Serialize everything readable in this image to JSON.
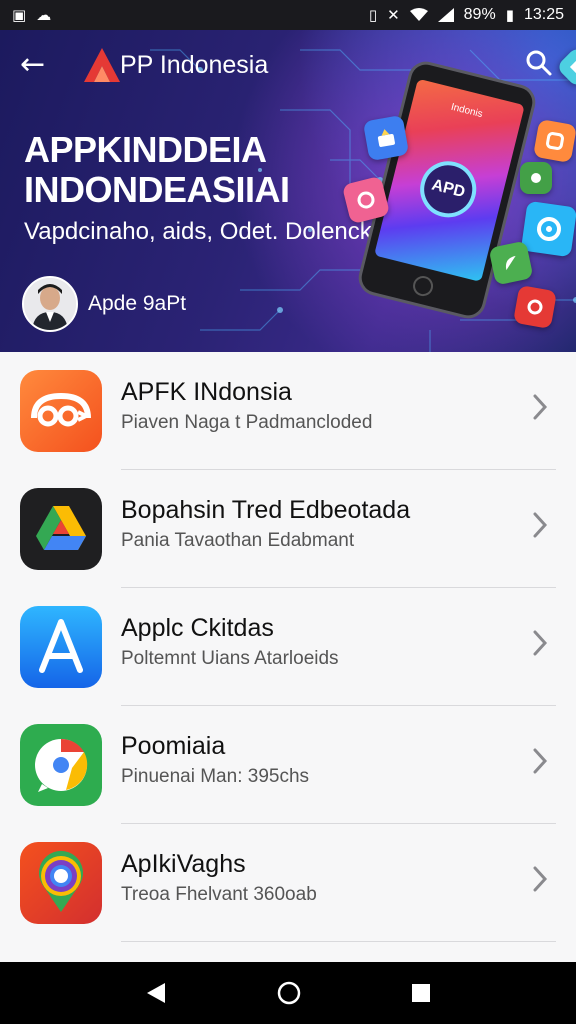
{
  "status_bar": {
    "battery": "89%",
    "time": "13:25",
    "glyphs": {
      "image": "▣",
      "cloud": "☁",
      "vibrate": "▯",
      "mute": "✕",
      "battery": "▮"
    }
  },
  "header": {
    "back_glyph": "←",
    "brand_letter": "A",
    "brand_text": "PP Indonesia",
    "title_line1": "APPKINDDEIA",
    "title_line2": "INDONDEASIIAI",
    "subtitle": "Vapdcinaho, aids, Odet. Dolenck",
    "author_name": "Apde 9aPt",
    "phone_label": "Indonis",
    "phone_badge": "APD"
  },
  "apps": [
    {
      "title": "APFK INdonsia",
      "subtitle": "Piaven Naga t Padmancloded",
      "icon": "orange-app-icon"
    },
    {
      "title": "Bopahsin Tred Edbeotada",
      "subtitle": "Pania Tavaothan Edabmant",
      "icon": "drive-app-icon"
    },
    {
      "title": "Applc Ckitdas",
      "subtitle": "Poltemnt Uians Atarloeids",
      "icon": "app-store-icon"
    },
    {
      "title": "Poomiaia",
      "subtitle": "Pinuenai Man: 395chs",
      "icon": "chrome-app-icon"
    },
    {
      "title": "ApIkiVaghs",
      "subtitle": "Treoa Fhelvant 360oab",
      "icon": "maps-app-icon"
    }
  ],
  "nav_glyphs": {
    "back": "◀",
    "home": "○",
    "recents": "■"
  },
  "colors": {
    "hero_dark": "#1c1a5e",
    "hero_accent": "#7b3fc4",
    "brand_red": "#e53935",
    "divider": "#d9d9dc"
  }
}
